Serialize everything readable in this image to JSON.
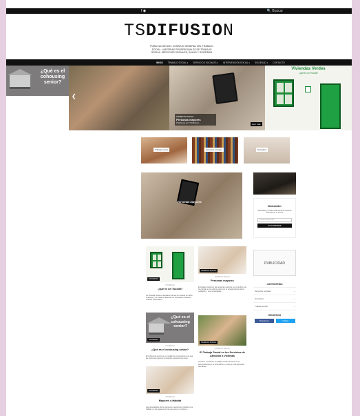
{
  "topbar": {
    "social": "f ◉",
    "search": "🔍 Buscar"
  },
  "brand": {
    "logo_thin": "TS",
    "logo_bold": "DIFUSI",
    "logo_o": "O",
    "logo_end": "N",
    "tagline": "PUBLICACIÓN DEL CONSEJO GENERAL DEL TRABAJO SOCIAL · MATERIAS PROFESIONALES DE TRABAJO SOCIAL: SERVICIOS SOCIALES, SALUD Y SOCIEDAD"
  },
  "nav": {
    "items": [
      "INICIO",
      "TRABAJO SOCIAL ▾",
      "SERVICIOS SOCIALES ▾",
      "INTERVENCIÓN SOCIAL ▾",
      "SOCIEDAD ▾",
      "CONTACTO"
    ]
  },
  "slider": {
    "s1_title": "¿Qué es el cohousing senior?",
    "s3_cat": "TRABAJO SOCIAL",
    "s3_title": "Personas mayores",
    "s3_sub": "Publicado por TSdifusion",
    "s3_badge": "Leer más",
    "s4_title": "Viviendas Verdes",
    "s4_sub": "¿qué es un Tsocial?",
    "arrow": "❮"
  },
  "mini": [
    "Trabajo social",
    "Servicios sociales",
    "Sociedad"
  ],
  "feature": {
    "label": "Personas mayores"
  },
  "newsletter": {
    "title": "Newsletter",
    "desc": "Suscríbete y recibe cada semana nuestros artículos en tu correo",
    "placeholder": "Correo electrónico",
    "button": "SUSCRIBIRME"
  },
  "publicidad": "PUBLICIDAD",
  "categorias": {
    "title": "CATEGORÍAS",
    "items": [
      "Servicios sociales",
      "Sociedad",
      "Trabajo social"
    ]
  },
  "siguenos": {
    "title": "SÍGUENOS",
    "fb": "f Facebook",
    "tw": "t Twitter"
  },
  "cards": [
    {
      "cat": "SOCIEDAD",
      "title": "¿qué es un Tsocial?",
      "tag": "SOCIEDAD",
      "ex": "La vivienda verde es aquella en la que se respeta el medio ambiente y se cuida la salud de sus ocupantes mediante criterios sostenibles..."
    },
    {
      "cat": "TRABAJO SOCIAL",
      "title": "Personas mayores",
      "tag": "TRABAJO SOCIAL",
      "ex": "El trabajo social con las personas mayores es un ámbito que ha crecido en los últimos años por el envejecimiento de la población y sus necesidades..."
    },
    {
      "cat": "SOCIEDAD",
      "title": "¿Qué es el cohousing senior?",
      "tag": "SOCIEDAD",
      "ex": "El cohousing senior es un modelo de convivencia en el que las personas mayores comparten espacios comunes..."
    },
    {
      "cat": "TRABAJO SOCIAL",
      "title": "El Trabajo Social en los Servicios de Atención a Víctimas",
      "tag": "TRABAJO SOCIAL",
      "ex": "Atención a víctimas: el trabajo social interviene en el acompañamiento, la orientación y el apoyo a las personas afectadas..."
    },
    {
      "cat": "SOCIEDAD",
      "title": "Mayores y Hábitat",
      "tag": "SOCIEDAD",
      "ex": "Las necesidades de las personas mayores en relación a su hábitat y a los espacios en los que viven y conviven..."
    }
  ],
  "colors": {
    "brand_dark": "#111111",
    "green": "#1d8a39",
    "page_bg": "#e6cfe1"
  }
}
